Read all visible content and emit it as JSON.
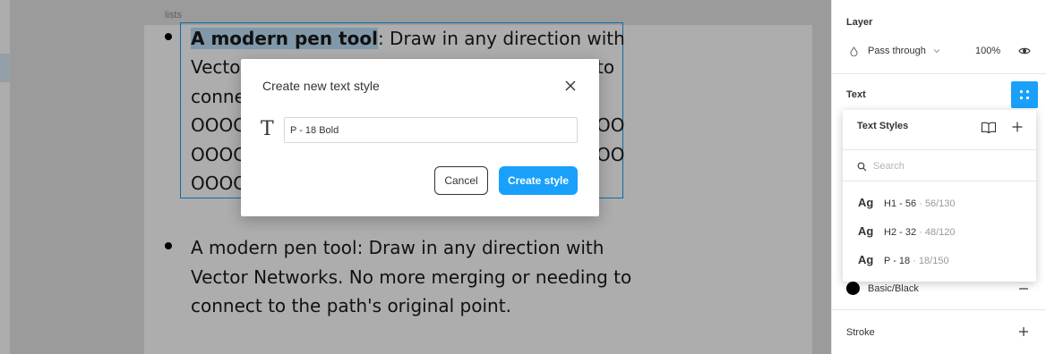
{
  "canvas": {
    "frame_label": "lists",
    "item1": {
      "bold": "A modern pen tool",
      "line1_rest": ": Draw in any direction with",
      "line2_start": "Vecto",
      "line2_end": "to",
      "line3_start": "conne",
      "line4_start": "OOOC",
      "line4_end": "OO",
      "line5_start": "OOOC",
      "line5_end": "OO",
      "line6_start": "OOOC"
    },
    "item2": {
      "line1": "A modern pen tool: Draw in any direction with",
      "line2": "Vector Networks. No more merging or needing to",
      "line3": "connect to the path's original point."
    }
  },
  "modal": {
    "title": "Create new text style",
    "input_value": "P - 18 Bold",
    "cancel_label": "Cancel",
    "create_label": "Create style"
  },
  "panel": {
    "layer": {
      "title": "Layer",
      "blend_mode": "Pass through",
      "opacity": "100%"
    },
    "text": {
      "title": "Text"
    },
    "text_styles": {
      "title": "Text Styles",
      "search_placeholder": "Search",
      "items": [
        {
          "ag": "Ag",
          "name": "H1 - 56",
          "meta": " · 56/130"
        },
        {
          "ag": "Ag",
          "name": "H2 - 32",
          "meta": " · 48/120"
        },
        {
          "ag": "Ag",
          "name": "P - 18",
          "meta": " · 18/150"
        }
      ]
    },
    "fill": {
      "color_name": "Basic/Black",
      "swatch": "#000000"
    },
    "stroke": {
      "title": "Stroke"
    }
  },
  "colors": {
    "accent": "#18a0fb",
    "selection_highlight": "#bde0f7"
  }
}
